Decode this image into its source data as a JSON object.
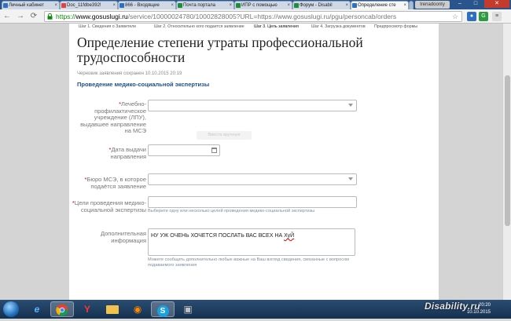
{
  "browser": {
    "tabs": [
      {
        "label": "Личный кабинет",
        "favicon_color": "#2e6fbf"
      },
      {
        "label": "Doc_11fdbe392!",
        "favicon_color": "#d44"
      },
      {
        "label": "866 - Входящие",
        "favicon_color": "#2e6fbf"
      },
      {
        "label": "Почта портала",
        "favicon_color": "#1f8d3a"
      },
      {
        "label": "ИПР с помощью",
        "favicon_color": "#1f8d3a"
      },
      {
        "label": "Форум - Disabil",
        "favicon_color": "#1f8d3a"
      },
      {
        "label": "Определение сте",
        "favicon_color": "#2e6fbf"
      }
    ],
    "profile_label": "Irenadoonty",
    "url": {
      "scheme": "https://",
      "host": "www.gosuslugi.ru",
      "path": "/service/10000024780/10002828005?URL=https://www.gosuslugi.ru/pgu/personcab/orders"
    }
  },
  "form": {
    "steps": [
      "Шаг 1. Сведения о Заявителе",
      "Шаг 2. Относительно кого подается заявление",
      "Шаг 3. Цель заявления",
      "Шаг 4. Загрузка документов",
      "Предпросмотр формы"
    ],
    "title": "Определение степени утраты профессиональной трудоспособности",
    "draft_saved": "Черновик заявления сохранен 10.10.2015 20:19",
    "section_title": "Проведение медико-социальной экспертизы",
    "fields": {
      "lpu": {
        "required": "*",
        "label": "Лечебно-профилактическое учреждение (ЛПУ), выдавшее направление на МСЭ",
        "value": ""
      },
      "grey_button": "Ввести вручную",
      "date": {
        "required": "*",
        "label": "Дата выдачи направления",
        "value": ""
      },
      "bureau": {
        "required": "*",
        "label": "Бюро МСЭ, в которое подаётся заявление",
        "value": ""
      },
      "goals": {
        "required": "*",
        "label": "Цели проведения медико-социальной экспертизы",
        "value": "",
        "hint": "Выберите одну или несколько целей проведения медико-социальной экспертизы"
      },
      "additional": {
        "label": "Дополнительная информация",
        "value_text": "НУ УЖ ОЧЕНЬ ХОЧЕТСЯ ПОСЛАТЬ ВАС ВСЕХ НА ",
        "value_word": "ХуЙ",
        "hint": "Можете сообщить дополнительно любые важные на Ваш взгляд сведения, связанные с вопросом подаваемого заявления"
      }
    }
  },
  "taskbar": {
    "apps": [
      "ie-icon",
      "chrome-icon",
      "yandex-icon",
      "folder-icon",
      "media-icon",
      "skype-icon",
      "unknown-icon"
    ],
    "clock_time": "20:20",
    "clock_date": "10.10.2015",
    "watermark": "Disability.ru"
  }
}
